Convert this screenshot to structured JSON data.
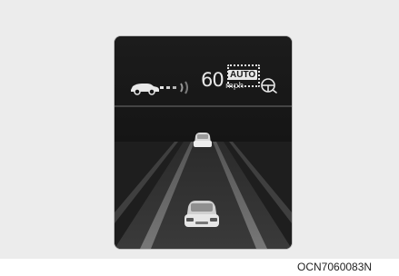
{
  "display": {
    "set_speed": "60",
    "speed_unit": "mph",
    "auto_badge": "AUTO"
  },
  "icons": {
    "preceding_vehicle": "car-side-icon",
    "distance_indicator": "distance-waves-icon",
    "cruise_control": "steering-wheel-cruise-icon",
    "lead_vehicle": "lead-car-icon",
    "own_vehicle": "own-car-icon"
  },
  "colors": {
    "screen_background": "#161616",
    "display_foreground": "#e8e8e8",
    "panel_background": "#ececec"
  },
  "figure_code": "OCN7060083N"
}
